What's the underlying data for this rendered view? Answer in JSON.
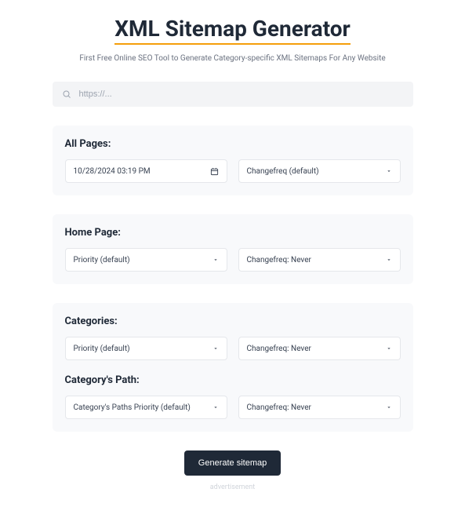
{
  "header": {
    "title": "XML Sitemap Generator",
    "subtitle": "First Free Online SEO Tool to Generate Category-specific XML Sitemaps For Any Website"
  },
  "search": {
    "placeholder": "https://..."
  },
  "sections": {
    "all_pages": {
      "title": "All Pages:",
      "datetime": "10/28/2024 03:19 PM",
      "changefreq": "Changefreq (default)"
    },
    "home_page": {
      "title": "Home Page:",
      "priority": "Priority (default)",
      "changefreq": "Changefreq: Never"
    },
    "categories": {
      "title": "Categories:",
      "priority": "Priority (default)",
      "changefreq": "Changefreq: Never"
    },
    "category_path": {
      "title": "Category's Path:",
      "priority": "Category's Paths Priority (default)",
      "changefreq": "Changefreq: Never"
    }
  },
  "actions": {
    "generate": "Generate sitemap"
  },
  "footer": {
    "ad_label": "advertisement"
  }
}
